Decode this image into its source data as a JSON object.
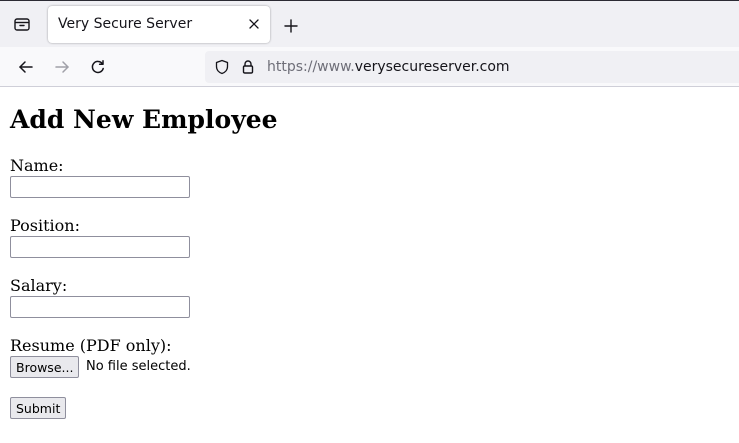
{
  "browser": {
    "tab": {
      "title": "Very Secure Server",
      "close_icon": "close-icon"
    },
    "icons": {
      "tab_list": "tab-list-icon",
      "new_tab": "plus-icon",
      "back": "back-arrow-icon",
      "forward": "forward-arrow-icon",
      "reload": "reload-icon",
      "tracking_protection": "shield-icon",
      "secure": "lock-icon"
    },
    "url": {
      "scheme_prefix": "https://www.",
      "host": "verysecureserver.com"
    }
  },
  "page": {
    "title": "Add New Employee",
    "form": {
      "name_label": "Name:",
      "name_value": "",
      "position_label": "Position:",
      "position_value": "",
      "salary_label": "Salary:",
      "salary_value": "",
      "resume_label": "Resume (PDF only):",
      "browse_label": "Browse...",
      "file_status": "No file selected.",
      "submit_label": "Submit"
    }
  },
  "colors": {
    "tabstrip_bg": "#f0f0f4",
    "toolbar_bg": "#f9f9fb",
    "urlbar_bg": "#f0f0f4",
    "button_bg": "#e9e9ed"
  }
}
